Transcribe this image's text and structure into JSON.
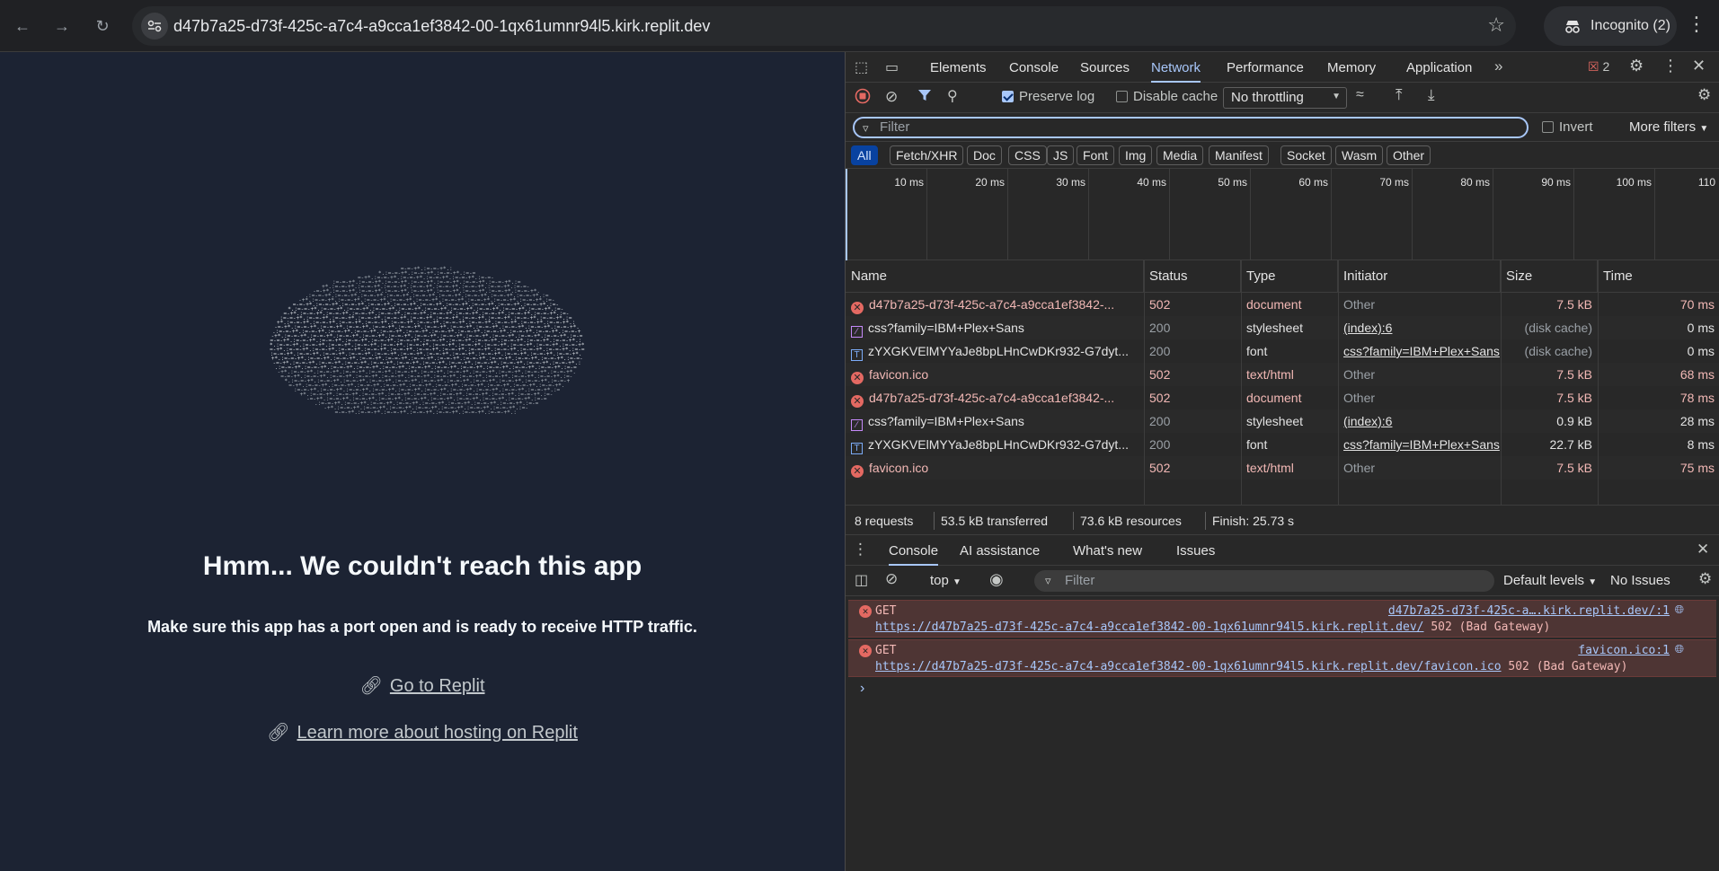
{
  "browser": {
    "url": "d47b7a25-d73f-425c-a7c4-a9cca1ef3842-00-1qx61umnr94l5.kirk.replit.dev",
    "incognito_label": "Incognito (2)"
  },
  "page": {
    "title": "Hmm... We couldn't reach this app",
    "description": "Make sure this app has a port open and is ready to receive HTTP traffic.",
    "link_replit": "Go to Replit",
    "link_hosting": "Learn more about hosting on Replit"
  },
  "devtools": {
    "tabs": [
      "Elements",
      "Console",
      "Sources",
      "Network",
      "Performance",
      "Memory",
      "Application"
    ],
    "active_tab": "Network",
    "error_count": "2",
    "toolbar": {
      "preserve_log": "Preserve log",
      "disable_cache": "Disable cache",
      "throttling": "No throttling"
    },
    "filter_placeholder": "Filter",
    "invert_label": "Invert",
    "more_filters": "More filters",
    "type_filters": [
      "All",
      "Fetch/XHR",
      "Doc",
      "CSS",
      "JS",
      "Font",
      "Img",
      "Media",
      "Manifest",
      "Socket",
      "Wasm",
      "Other"
    ],
    "timeline_ticks": [
      "10 ms",
      "20 ms",
      "30 ms",
      "40 ms",
      "50 ms",
      "60 ms",
      "70 ms",
      "80 ms",
      "90 ms",
      "100 ms",
      "110"
    ],
    "columns": [
      "Name",
      "Status",
      "Type",
      "Initiator",
      "Size",
      "Time"
    ],
    "requests": [
      {
        "icon": "error",
        "name": "d47b7a25-d73f-425c-a7c4-a9cca1ef3842-...",
        "status": "502",
        "type": "document",
        "initiator": "Other",
        "size": "7.5 kB",
        "time": "70 ms"
      },
      {
        "icon": "css",
        "name": "css?family=IBM+Plex+Sans",
        "status": "200",
        "type": "stylesheet",
        "initiator": "(index):6",
        "size": "(disk cache)",
        "time": "0 ms"
      },
      {
        "icon": "font",
        "name": "zYXGKVElMYYaJe8bpLHnCwDKr932-G7dyt...",
        "status": "200",
        "type": "font",
        "initiator": "css?family=IBM+Plex+Sans",
        "size": "(disk cache)",
        "time": "0 ms"
      },
      {
        "icon": "error",
        "name": "favicon.ico",
        "status": "502",
        "type": "text/html",
        "initiator": "Other",
        "size": "7.5 kB",
        "time": "68 ms"
      },
      {
        "icon": "error",
        "name": "d47b7a25-d73f-425c-a7c4-a9cca1ef3842-...",
        "status": "502",
        "type": "document",
        "initiator": "Other",
        "size": "7.5 kB",
        "time": "78 ms"
      },
      {
        "icon": "css",
        "name": "css?family=IBM+Plex+Sans",
        "status": "200",
        "type": "stylesheet",
        "initiator": "(index):6",
        "size": "0.9 kB",
        "time": "28 ms"
      },
      {
        "icon": "font",
        "name": "zYXGKVElMYYaJe8bpLHnCwDKr932-G7dyt...",
        "status": "200",
        "type": "font",
        "initiator": "css?family=IBM+Plex+Sans",
        "size": "22.7 kB",
        "time": "8 ms"
      },
      {
        "icon": "error",
        "name": "favicon.ico",
        "status": "502",
        "type": "text/html",
        "initiator": "Other",
        "size": "7.5 kB",
        "time": "75 ms"
      }
    ],
    "summary": [
      "8 requests",
      "53.5 kB transferred",
      "73.6 kB resources",
      "Finish: 25.73 s"
    ],
    "drawer_tabs": [
      "Console",
      "AI assistance",
      "What's new",
      "Issues"
    ],
    "console_context": "top",
    "console_filter": "Filter",
    "default_levels": "Default levels",
    "no_issues": "No Issues",
    "console_messages": [
      {
        "method": "GET",
        "url": "https://d47b7a25-d73f-425c-a7c4-a9cca1ef3842-00-1qx61umnr94l5.kirk.replit.dev/",
        "status": "502 (Bad Gateway)",
        "source": "d47b7a25-d73f-425c-a….kirk.replit.dev/:1"
      },
      {
        "method": "GET",
        "url": "https://d47b7a25-d73f-425c-a7c4-a9cca1ef3842-00-1qx61umnr94l5.kirk.replit.dev/favicon.ico",
        "status": "502 (Bad Gateway)",
        "source": "favicon.ico:1"
      }
    ]
  }
}
